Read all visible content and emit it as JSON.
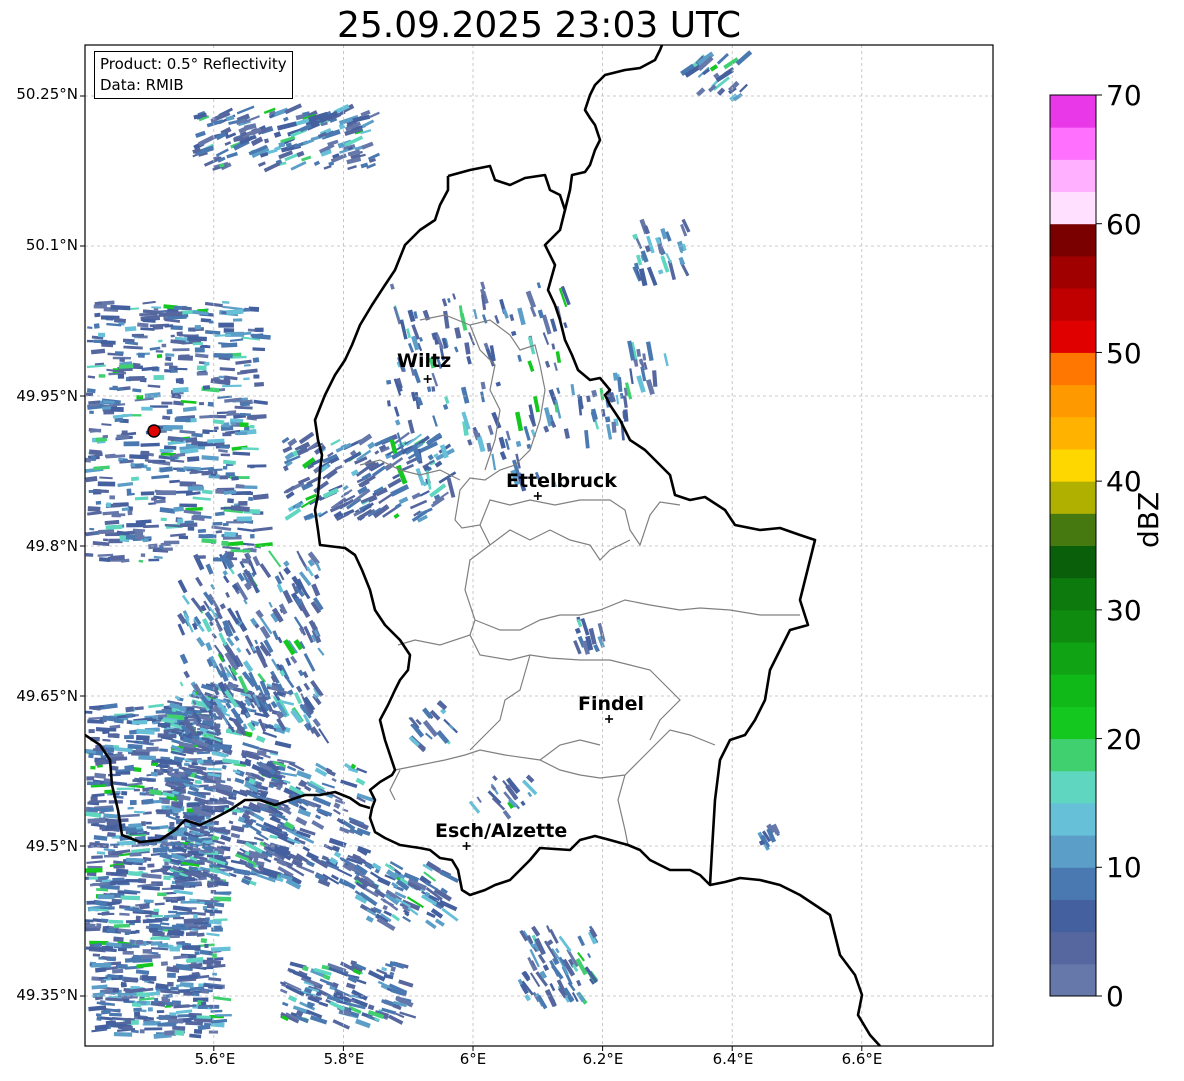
{
  "title": "25.09.2025 23:03 UTC",
  "info_box": {
    "product": "Product: 0.5° Reflectivity",
    "data": "Data: RMIB"
  },
  "y_axis_labels": [
    "50.25°N",
    "50.1°N",
    "49.95°N",
    "49.8°N",
    "49.65°N",
    "49.5°N",
    "49.35°N"
  ],
  "x_axis_labels": [
    "5.6°E",
    "5.8°E",
    "6°E",
    "6.2°E",
    "6.4°E",
    "6.6°E"
  ],
  "cities": [
    {
      "name": "Wiltz",
      "lon": 5.93,
      "lat": 49.967
    },
    {
      "name": "Ettelbruck",
      "lon": 6.1,
      "lat": 49.85
    },
    {
      "name": "Findel",
      "lon": 6.21,
      "lat": 49.627
    },
    {
      "name": "Esch/Alzette",
      "lon": 5.99,
      "lat": 49.5
    }
  ],
  "radar_site_color": "#e00000",
  "colorbar": {
    "label": "dBZ",
    "ticks": [
      "0",
      "10",
      "20",
      "30",
      "40",
      "50",
      "60",
      "70"
    ],
    "colors": [
      "#6677aa",
      "#55679e",
      "#45609f",
      "#4a78b0",
      "#5b9ec8",
      "#66c0d8",
      "#5fd6c0",
      "#40d070",
      "#14c820",
      "#10b818",
      "#10a414",
      "#0f8c10",
      "#0d7a0d",
      "#0a600a",
      "#467a10",
      "#b0b000",
      "#ffd700",
      "#ffb300",
      "#ff9900",
      "#ff7700",
      "#e00000",
      "#c00000",
      "#a00000",
      "#7a0000",
      "#ffe0ff",
      "#ffb0ff",
      "#ff70ff",
      "#e838e8"
    ]
  }
}
